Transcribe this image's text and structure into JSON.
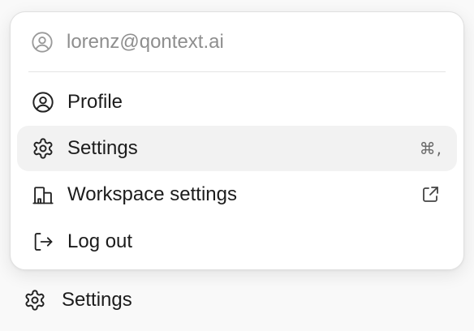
{
  "menu": {
    "email": "lorenz@qontext.ai",
    "items": [
      {
        "label": "Profile",
        "icon": "user-circle-icon"
      },
      {
        "label": "Settings",
        "icon": "gear-icon",
        "shortcut": "⌘,"
      },
      {
        "label": "Workspace settings",
        "icon": "building-icon",
        "trailing_icon": "external-link-icon"
      },
      {
        "label": "Log out",
        "icon": "logout-icon"
      }
    ]
  },
  "sidebar": {
    "settings_label": "Settings"
  },
  "colors": {
    "hover_background": "#f2f2f2",
    "muted_text": "#8e8e8e",
    "text": "#1c1c1c"
  }
}
